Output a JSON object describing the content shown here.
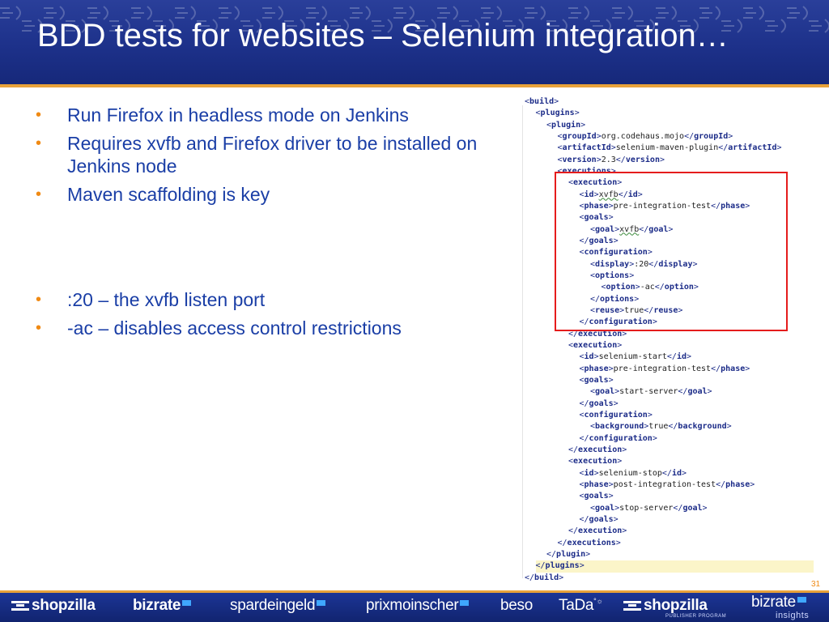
{
  "slide": {
    "title": "BDD tests for websites – Selenium integration…",
    "bullets_top": [
      "Run Firefox in headless mode on Jenkins",
      "Requires xvfb and Firefox driver to be installed on Jenkins node",
      "Maven scaffolding is key"
    ],
    "bullets_bottom": [
      ":20 – the xvfb listen port",
      "-ac – disables access control restrictions"
    ],
    "page_number": "31"
  },
  "code": [
    {
      "depth": 0,
      "tag": "build",
      "kind": "open"
    },
    {
      "depth": 1,
      "tag": "plugins",
      "kind": "open"
    },
    {
      "depth": 2,
      "tag": "plugin",
      "kind": "open"
    },
    {
      "depth": 3,
      "tag": "groupId",
      "kind": "value",
      "value": "org.codehaus.mojo"
    },
    {
      "depth": 3,
      "tag": "artifactId",
      "kind": "value",
      "value": "selenium-maven-plugin"
    },
    {
      "depth": 3,
      "tag": "version",
      "kind": "value",
      "value": "2.3"
    },
    {
      "depth": 3,
      "tag": "executions",
      "kind": "open"
    },
    {
      "depth": 4,
      "tag": "execution",
      "kind": "open"
    },
    {
      "depth": 5,
      "tag": "id",
      "kind": "value",
      "value": "xvfb",
      "wavy": true
    },
    {
      "depth": 5,
      "tag": "phase",
      "kind": "value",
      "value": "pre-integration-test"
    },
    {
      "depth": 5,
      "tag": "goals",
      "kind": "open"
    },
    {
      "depth": 6,
      "tag": "goal",
      "kind": "value",
      "value": "xvfb",
      "wavy": true
    },
    {
      "depth": 5,
      "tag": "goals",
      "kind": "close"
    },
    {
      "depth": 5,
      "tag": "configuration",
      "kind": "open"
    },
    {
      "depth": 6,
      "tag": "display",
      "kind": "value",
      "value": ":20"
    },
    {
      "depth": 6,
      "tag": "options",
      "kind": "open"
    },
    {
      "depth": 7,
      "tag": "option",
      "kind": "value",
      "value": "-ac"
    },
    {
      "depth": 6,
      "tag": "options",
      "kind": "close"
    },
    {
      "depth": 6,
      "tag": "reuse",
      "kind": "value",
      "value": "true"
    },
    {
      "depth": 5,
      "tag": "configuration",
      "kind": "close"
    },
    {
      "depth": 4,
      "tag": "execution",
      "kind": "close"
    },
    {
      "depth": 4,
      "tag": "execution",
      "kind": "open"
    },
    {
      "depth": 5,
      "tag": "id",
      "kind": "value",
      "value": "selenium-start"
    },
    {
      "depth": 5,
      "tag": "phase",
      "kind": "value",
      "value": "pre-integration-test"
    },
    {
      "depth": 5,
      "tag": "goals",
      "kind": "open"
    },
    {
      "depth": 6,
      "tag": "goal",
      "kind": "value",
      "value": "start-server"
    },
    {
      "depth": 5,
      "tag": "goals",
      "kind": "close"
    },
    {
      "depth": 5,
      "tag": "configuration",
      "kind": "open"
    },
    {
      "depth": 6,
      "tag": "background",
      "kind": "value",
      "value": "true"
    },
    {
      "depth": 5,
      "tag": "configuration",
      "kind": "close"
    },
    {
      "depth": 4,
      "tag": "execution",
      "kind": "close"
    },
    {
      "depth": 4,
      "tag": "execution",
      "kind": "open"
    },
    {
      "depth": 5,
      "tag": "id",
      "kind": "value",
      "value": "selenium-stop"
    },
    {
      "depth": 5,
      "tag": "phase",
      "kind": "value",
      "value": "post-integration-test"
    },
    {
      "depth": 5,
      "tag": "goals",
      "kind": "open"
    },
    {
      "depth": 6,
      "tag": "goal",
      "kind": "value",
      "value": "stop-server"
    },
    {
      "depth": 5,
      "tag": "goals",
      "kind": "close"
    },
    {
      "depth": 4,
      "tag": "execution",
      "kind": "close"
    },
    {
      "depth": 3,
      "tag": "executions",
      "kind": "close"
    },
    {
      "depth": 2,
      "tag": "plugin",
      "kind": "close"
    },
    {
      "depth": 1,
      "tag": "plugins",
      "kind": "close",
      "highlight": true
    },
    {
      "depth": 0,
      "tag": "build",
      "kind": "close"
    }
  ],
  "footer": {
    "logos": [
      {
        "name": "shopzilla-logo",
        "text": "shopzilla"
      },
      {
        "name": "bizrate-logo",
        "text": "bizrate"
      },
      {
        "name": "spardeingeld-logo",
        "text": "spardeingeld"
      },
      {
        "name": "prixmoinscher-logo",
        "text": "prixmoinscher"
      },
      {
        "name": "beso-logo",
        "text": "beso"
      },
      {
        "name": "tada-logo",
        "text": "TaDa"
      },
      {
        "name": "shopzilla-publisher-logo",
        "text": "shopzilla",
        "sub": "PUBLISHER PROGRAM"
      },
      {
        "name": "bizrate-insights-logo",
        "text": "bizrate",
        "sub": "insights"
      }
    ]
  },
  "colors": {
    "header_blue": "#1d318a",
    "accent_orange": "#e8a23a",
    "bullet_text": "#1a3ea6",
    "highlight_box": "#e51c1c"
  }
}
